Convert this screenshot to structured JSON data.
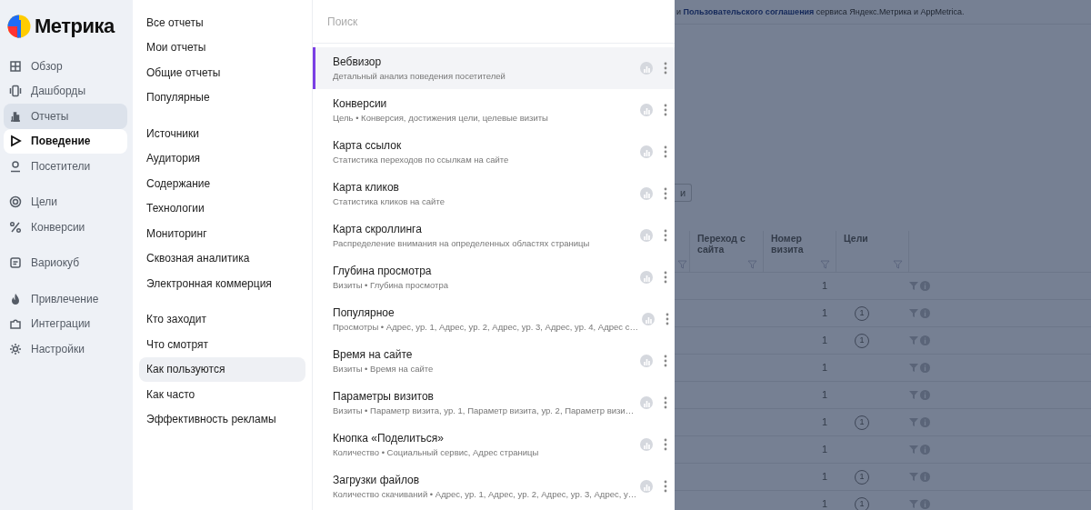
{
  "sidebar": {
    "logo": "Метрика",
    "groups": [
      [
        {
          "label": "Обзор",
          "selected": false,
          "open": false
        },
        {
          "label": "Дашборды",
          "selected": false,
          "open": false
        },
        {
          "label": "Отчеты",
          "selected": true,
          "open": false
        },
        {
          "label": "Поведение",
          "selected": false,
          "open": true
        },
        {
          "label": "Посетители",
          "selected": false,
          "open": false
        }
      ],
      [
        {
          "label": "Цели",
          "selected": false,
          "open": false
        },
        {
          "label": "Конверсии",
          "selected": false,
          "open": false
        }
      ],
      [
        {
          "label": "Вариокуб",
          "selected": false,
          "open": false
        }
      ],
      [
        {
          "label": "Привлечение",
          "selected": false,
          "open": false
        },
        {
          "label": "Интеграции",
          "selected": false,
          "open": false
        },
        {
          "label": "Настройки",
          "selected": false,
          "open": false
        }
      ]
    ]
  },
  "categories": [
    [
      {
        "label": "Все отчеты",
        "selected": false
      },
      {
        "label": "Мои отчеты",
        "selected": false
      },
      {
        "label": "Общие отчеты",
        "selected": false
      },
      {
        "label": "Популярные",
        "selected": false
      }
    ],
    [
      {
        "label": "Источники",
        "selected": false
      },
      {
        "label": "Аудитория",
        "selected": false
      },
      {
        "label": "Содержание",
        "selected": false
      },
      {
        "label": "Технологии",
        "selected": false
      },
      {
        "label": "Мониторинг",
        "selected": false
      },
      {
        "label": "Сквозная аналитика",
        "selected": false
      },
      {
        "label": "Электронная коммерция",
        "selected": false
      }
    ],
    [
      {
        "label": "Кто заходит",
        "selected": false
      },
      {
        "label": "Что смотрят",
        "selected": false
      },
      {
        "label": "Как пользуются",
        "selected": true
      },
      {
        "label": "Как часто",
        "selected": false
      },
      {
        "label": "Эффективность рекламы",
        "selected": false
      }
    ]
  ],
  "reports": {
    "search": {
      "placeholder": "Поиск"
    },
    "items": [
      {
        "title": "Вебвизор",
        "subtitle": "Детальный анализ поведения посетителей",
        "selected": true
      },
      {
        "title": "Конверсии",
        "subtitle": "Цель • Конверсия, достижения цели, целевые визиты",
        "selected": false
      },
      {
        "title": "Карта ссылок",
        "subtitle": "Статистика переходов по ссылкам на сайте",
        "selected": false
      },
      {
        "title": "Карта кликов",
        "subtitle": "Статистика кликов на сайте",
        "selected": false
      },
      {
        "title": "Карта скроллинга",
        "subtitle": "Распределение внимания на определенных областях страницы",
        "selected": false
      },
      {
        "title": "Глубина просмотра",
        "subtitle": "Визиты • Глубина просмотра",
        "selected": false
      },
      {
        "title": "Популярное",
        "subtitle": "Просмотры • Адрес, ур. 1, Адрес, ур. 2, Адрес, ур. 3, Адрес, ур. 4, Адрес с…",
        "selected": false
      },
      {
        "title": "Время на сайте",
        "subtitle": "Визиты • Время на сайте",
        "selected": false
      },
      {
        "title": "Параметры визитов",
        "subtitle": "Визиты • Параметр визита, ур. 1, Параметр визита, ур. 2, Параметр визи…",
        "selected": false
      },
      {
        "title": "Кнопка «Поделиться»",
        "subtitle": "Количество • Социальный сервис, Адрес страницы",
        "selected": false
      },
      {
        "title": "Загрузки файлов",
        "subtitle": "Количество скачиваний • Адрес, ур. 1, Адрес, ур. 2, Адрес, ур. 3, Адрес, у…",
        "selected": false
      }
    ]
  },
  "background": {
    "notice": {
      "before": "и ",
      "link": "Пользовательского соглашения",
      "after": " сервиса Яндекс.Метрика и AppMetrica."
    },
    "button": "и",
    "table": {
      "columns": [
        "Переход с сайта",
        "Номер визита",
        "Цели"
      ],
      "rows": [
        {
          "visit": "1",
          "goals": null
        },
        {
          "visit": "1",
          "goals": "1"
        },
        {
          "visit": "1",
          "goals": "1"
        },
        {
          "visit": "1",
          "goals": null
        },
        {
          "visit": "1",
          "goals": null
        },
        {
          "visit": "1",
          "goals": "1"
        },
        {
          "visit": "1",
          "goals": null
        },
        {
          "visit": "1",
          "goals": "1"
        },
        {
          "visit": "1",
          "goals": "1"
        }
      ]
    }
  }
}
